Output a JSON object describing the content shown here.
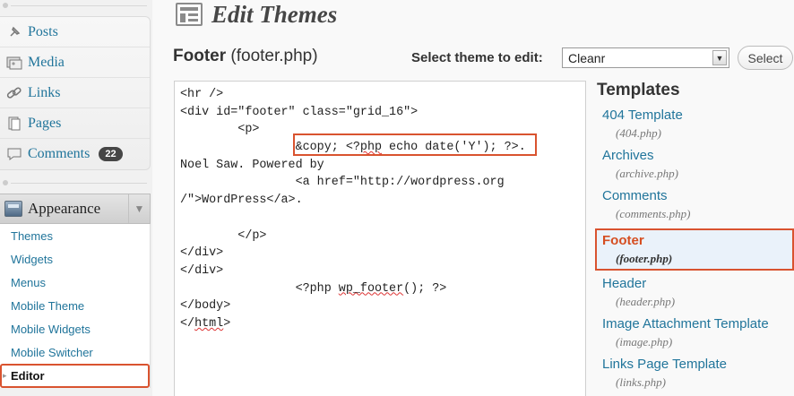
{
  "sidebar": {
    "primary_items": [
      {
        "label": "Posts",
        "icon": "pushpin-icon"
      },
      {
        "label": "Media",
        "icon": "media-icon"
      },
      {
        "label": "Links",
        "icon": "link-icon"
      },
      {
        "label": "Pages",
        "icon": "pages-icon"
      },
      {
        "label": "Comments",
        "icon": "comments-icon",
        "badge": "22"
      }
    ],
    "appearance": {
      "label": "Appearance"
    },
    "submenu": [
      "Themes",
      "Widgets",
      "Menus",
      "Mobile Theme",
      "Mobile Widgets",
      "Mobile Switcher",
      "Editor"
    ],
    "current_submenu": "Editor"
  },
  "header": {
    "title": "Edit Themes"
  },
  "file_heading": {
    "name": "Footer",
    "file": "(footer.php)"
  },
  "theme_selector": {
    "label": "Select theme to edit:",
    "value": "Cleanr",
    "button": "Select"
  },
  "editor": {
    "lines": [
      "<hr />",
      "<div id=\"footer\" class=\"grid_16\">",
      "        <p>",
      "                &copy; <?php echo date('Y'); ?>.",
      "Noel Saw. Powered by",
      "                <a href=\"http://wordpress.org",
      "/\">WordPress</a>.",
      "",
      "        </p>",
      "</div>",
      "</div>",
      "                <?php wp_footer(); ?>",
      "</body>",
      "</html>"
    ]
  },
  "templates": {
    "title": "Templates",
    "items": [
      {
        "name": "404 Template",
        "file": "(404.php)"
      },
      {
        "name": "Archives",
        "file": "(archive.php)"
      },
      {
        "name": "Comments",
        "file": "(comments.php)"
      },
      {
        "name": "Footer",
        "file": "(footer.php)"
      },
      {
        "name": "Header",
        "file": "(header.php)"
      },
      {
        "name": "Image Attachment Template",
        "file": "(image.php)"
      },
      {
        "name": "Links Page Template",
        "file": "(links.php)"
      }
    ],
    "current": "Footer"
  },
  "colors": {
    "link": "#21759b",
    "highlight": "#d9532f",
    "current_template_bg": "#eaf2fa"
  }
}
